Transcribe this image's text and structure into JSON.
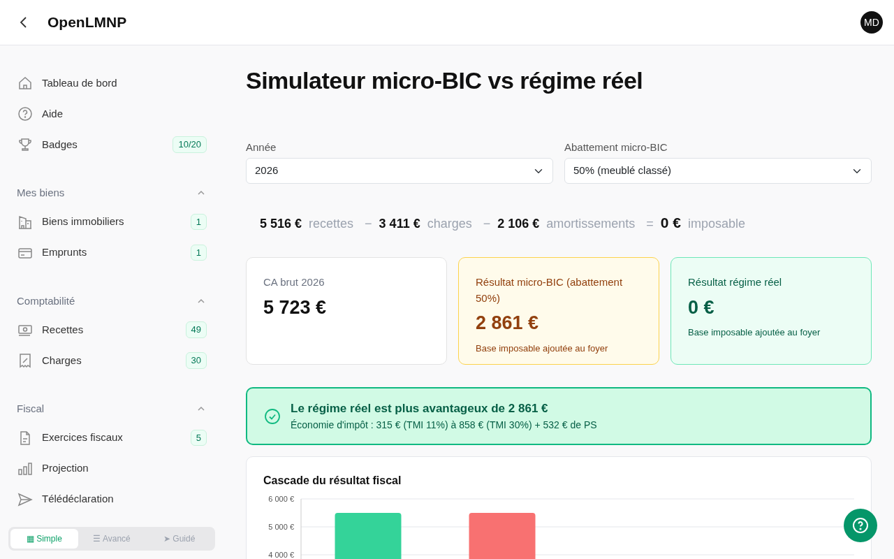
{
  "header": {
    "title": "OpenLMNP",
    "avatar": "MD"
  },
  "sidebar": {
    "items": [
      {
        "label": "Tableau de bord",
        "selected": false
      },
      {
        "label": "Aide",
        "selected": false
      },
      {
        "label": "Badges",
        "badge": "10/20",
        "selected": false
      }
    ],
    "sections": [
      {
        "title": "Mes biens",
        "expanded": true,
        "items": [
          {
            "label": "Biens immobiliers",
            "badge": "1",
            "selected": false
          },
          {
            "label": "Emprunts",
            "badge": "1",
            "selected": false
          }
        ]
      },
      {
        "title": "Comptabilité",
        "expanded": true,
        "items": [
          {
            "label": "Recettes",
            "badge": "49",
            "selected": false
          },
          {
            "label": "Charges",
            "badge": "30",
            "selected": false
          }
        ]
      },
      {
        "title": "Fiscal",
        "expanded": true,
        "items": [
          {
            "label": "Exercices fiscaux",
            "badge": "5",
            "selected": false
          },
          {
            "label": "Projection",
            "selected": false
          },
          {
            "label": "Télédéclaration",
            "selected": false
          }
        ]
      }
    ],
    "modes": [
      {
        "icon": "▦",
        "label": "Simple",
        "selected": true
      },
      {
        "icon": "☰",
        "label": "Avancé",
        "selected": false
      },
      {
        "icon": "➤",
        "label": "Guidé",
        "selected": false
      }
    ]
  },
  "page": {
    "title": "Simulateur micro-BIC vs régime réel",
    "fields": [
      {
        "label": "Année",
        "value": "2026"
      },
      {
        "label": "Abattement micro-BIC",
        "value": "50% (meublé classé)"
      }
    ],
    "formula": [
      {
        "kind": "amount",
        "text": "5 516 €"
      },
      {
        "kind": "label",
        "text": "recettes"
      },
      {
        "kind": "operator",
        "text": "−"
      },
      {
        "kind": "amount",
        "text": "3 411 €"
      },
      {
        "kind": "label",
        "text": "charges"
      },
      {
        "kind": "operator",
        "text": "−"
      },
      {
        "kind": "amount",
        "text": "2 106 €"
      },
      {
        "kind": "label",
        "text": "amortissements"
      },
      {
        "kind": "operator",
        "text": "="
      },
      {
        "kind": "total",
        "text": "0 €"
      },
      {
        "kind": "label",
        "text": "imposable"
      }
    ],
    "cards": [
      {
        "kind": "neutral",
        "title": "CA brut 2026",
        "value": "5 723 €"
      },
      {
        "kind": "warning",
        "title": "Résultat micro-BIC (abattement 50%)",
        "value": "2 861 €",
        "note": "Base imposable ajoutée au foyer"
      },
      {
        "kind": "success",
        "title": "Résultat régime réel",
        "value": "0 €",
        "note": "Base imposable ajoutée au foyer"
      }
    ],
    "alert": {
      "title": "Le régime réel est plus avantageux de 2 861 €",
      "text": "Économie d'impôt : 315 € (TMI 11%) à 858 € (TMI 30%) + 532 € de PS"
    },
    "chart": {
      "title": "Cascade du résultat fiscal",
      "chart_data": {
        "type": "bar",
        "series": [
          {
            "color": "#34d399",
            "values": [
              5500,
              null,
              null,
              null
            ]
          },
          {
            "color": "#f87171",
            "values": [
              null,
              5500,
              null,
              null
            ]
          }
        ],
        "ylim": [
          3750,
          6000
        ],
        "yticks": [
          {
            "value": 4000,
            "label": "4 000 €"
          },
          {
            "value": 5000,
            "label": "5 000 €"
          },
          {
            "value": 6000,
            "label": "6 000 €"
          }
        ]
      }
    }
  }
}
